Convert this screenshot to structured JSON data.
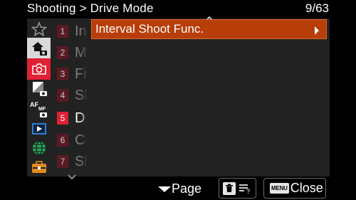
{
  "header": {
    "title": "Shooting > Drive Mode",
    "page_counter": "9/63"
  },
  "sidebar_icons": [
    {
      "name": "star-icon",
      "color": "#9a9a9a"
    },
    {
      "name": "home-camera-icon",
      "color": "#ffffff"
    },
    {
      "name": "camera-icon",
      "color": "#e02034"
    },
    {
      "name": "exposure-camera-icon",
      "color": "#ffffff"
    },
    {
      "name": "af-mf-camera-icon",
      "color": "#ffffff"
    },
    {
      "name": "playback-icon",
      "color": "#2f7fd0"
    },
    {
      "name": "network-globe-icon",
      "color": "#2aa84a"
    },
    {
      "name": "toolbox-icon",
      "color": "#e08a20"
    }
  ],
  "tabs": [
    {
      "num": "1",
      "letter": "In"
    },
    {
      "num": "2",
      "letter": "M"
    },
    {
      "num": "3",
      "letter": "Fi"
    },
    {
      "num": "4",
      "letter": "Sh"
    },
    {
      "num": "5",
      "letter": "Dr"
    },
    {
      "num": "6",
      "letter": "Co"
    },
    {
      "num": "7",
      "letter": "Sh"
    }
  ],
  "active_tab": "5",
  "menu": {
    "items": [
      {
        "label": "Interval Shoot Func."
      }
    ]
  },
  "footer": {
    "page_label": "Page",
    "delete_icon": "trash-icon",
    "sort_icon": "sort-list-icon",
    "menu_key": "MENU",
    "close_label": "Close"
  },
  "colors": {
    "accent": "#b83d08",
    "active_badge": "#e02034",
    "panel": "#222222"
  }
}
